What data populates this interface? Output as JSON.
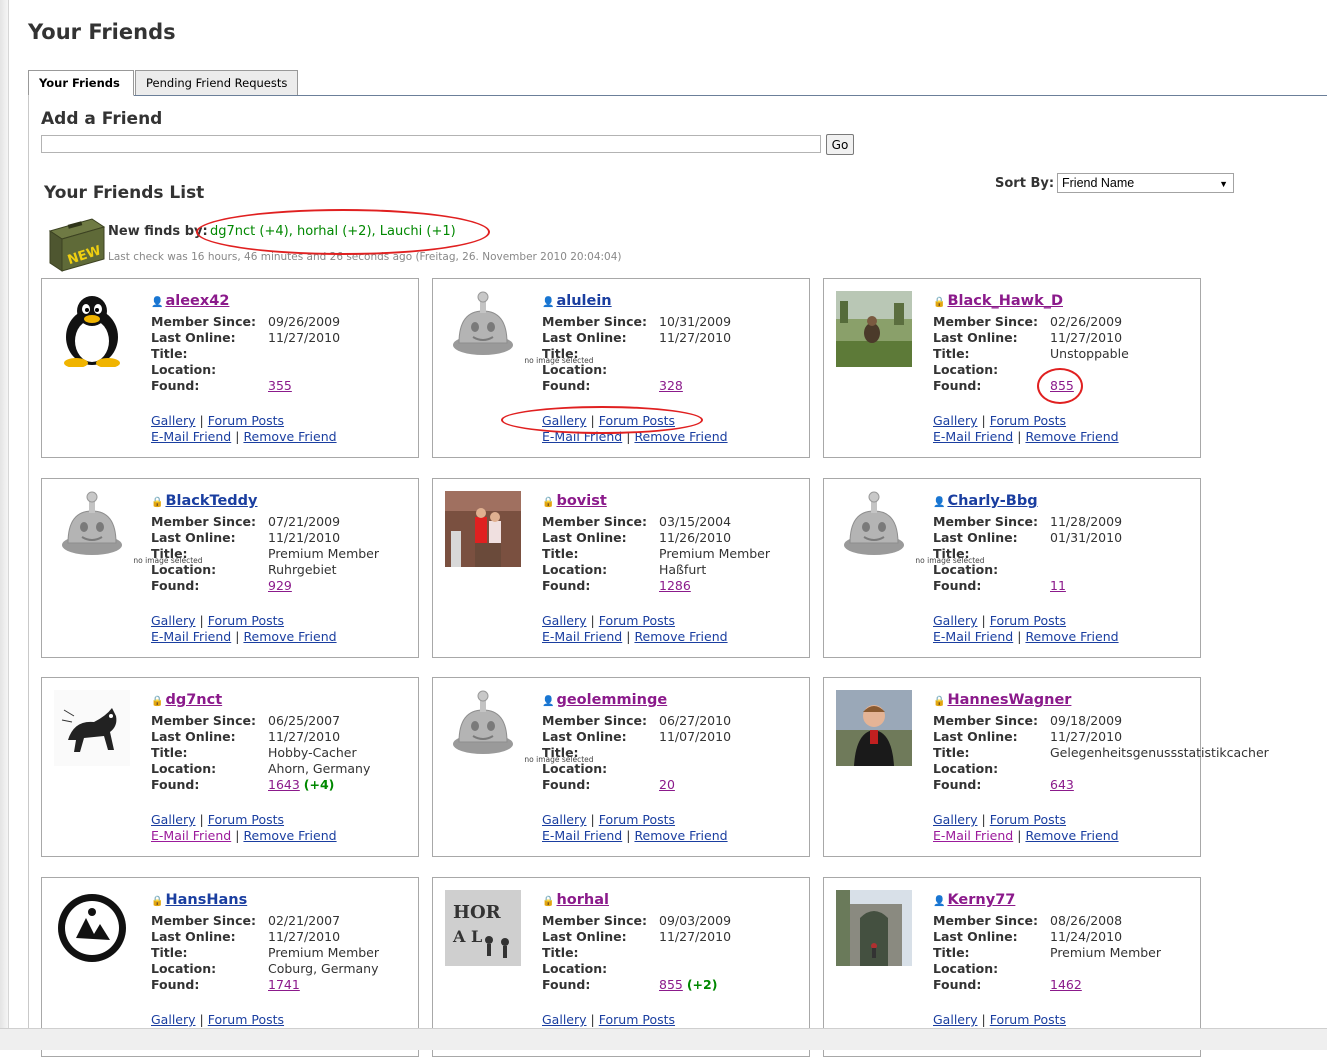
{
  "page": {
    "title": "Your Friends",
    "tabs": [
      {
        "label": "Your Friends",
        "active": true
      },
      {
        "label": "Pending Friend Requests",
        "active": false
      }
    ]
  },
  "add_friend": {
    "heading": "Add a Friend",
    "input_value": "",
    "go_label": "Go"
  },
  "friends_list": {
    "heading": "Your Friends List",
    "sort_label": "Sort By:",
    "sort_value": "Friend Name",
    "new_finds_label": "New finds by:",
    "new_finds_text": "dg7nct (+4), horhal (+2), Lauchi (+1)",
    "new_icon_text": "NEW",
    "last_check": "Last check was 16 hours, 46 minutes and 26 seconds ago (Freitag, 26. November 2010 20:04:04)"
  },
  "labels": {
    "member_since": "Member Since:",
    "last_online": "Last Online:",
    "title": "Title:",
    "location": "Location:",
    "found": "Found:",
    "gallery": "Gallery",
    "forum_posts": "Forum Posts",
    "email_friend": "E-Mail Friend",
    "remove_friend": "Remove Friend",
    "no_image": "no image selected"
  },
  "colors": {
    "link_blue": "#1a3ea0",
    "link_visited": "#8b1a8b",
    "new_finds_green": "#008800",
    "annotation_red": "#e02020"
  },
  "friends": [
    {
      "name": "aleex42",
      "member_since": "09/26/2009",
      "last_online": "11/27/2010",
      "title": "",
      "location": "",
      "found": "355",
      "found_extra": "",
      "avatar": "penguin",
      "premium": false,
      "visited": true,
      "email_visited": false
    },
    {
      "name": "alulein",
      "member_since": "10/31/2009",
      "last_online": "11/27/2010",
      "title": "",
      "location": "",
      "found": "328",
      "found_extra": "",
      "avatar": "none",
      "premium": false,
      "visited": false,
      "email_visited": false
    },
    {
      "name": "Black_Hawk_D",
      "member_since": "02/26/2009",
      "last_online": "11/27/2010",
      "title": "Unstoppable",
      "location": "",
      "found": "855",
      "found_extra": "",
      "avatar": "field-photo",
      "premium": true,
      "visited": true,
      "email_visited": false
    },
    {
      "name": "BlackTeddy",
      "member_since": "07/21/2009",
      "last_online": "11/21/2010",
      "title": "Premium Member",
      "location": "Ruhrgebiet",
      "found": "929",
      "found_extra": "",
      "avatar": "none",
      "premium": true,
      "visited": false,
      "email_visited": false
    },
    {
      "name": "bovist",
      "member_since": "03/15/2004",
      "last_online": "11/26/2010",
      "title": "Premium Member",
      "location": "Haßfurt",
      "found": "1286",
      "found_extra": "",
      "avatar": "people-photo",
      "premium": true,
      "visited": true,
      "email_visited": false
    },
    {
      "name": "Charly-Bbg",
      "member_since": "11/28/2009",
      "last_online": "01/31/2010",
      "title": "",
      "location": "",
      "found": "11",
      "found_extra": "",
      "avatar": "none",
      "premium": false,
      "visited": false,
      "email_visited": false
    },
    {
      "name": "dg7nct",
      "member_since": "06/25/2007",
      "last_online": "11/27/2010",
      "title": "Hobby-Cacher",
      "location": "Ahorn, Germany",
      "found": "1643",
      "found_extra": "(+4)",
      "avatar": "dog-drawing",
      "premium": true,
      "visited": true,
      "email_visited": true
    },
    {
      "name": "geolemminge",
      "member_since": "06/27/2010",
      "last_online": "11/07/2010",
      "title": "",
      "location": "",
      "found": "20",
      "found_extra": "",
      "avatar": "none",
      "premium": false,
      "visited": true,
      "email_visited": false
    },
    {
      "name": "HannesWagner",
      "member_since": "09/18/2009",
      "last_online": "11/27/2010",
      "title": "Gelegenheitsgenussstatistikcacher",
      "location": "",
      "found": "643",
      "found_extra": "",
      "avatar": "man-photo",
      "premium": true,
      "visited": true,
      "email_visited": true
    },
    {
      "name": "HansHans",
      "member_since": "02/21/2007",
      "last_online": "11/27/2010",
      "title": "Premium Member",
      "location": "Coburg, Germany",
      "found": "1741",
      "found_extra": "",
      "avatar": "hanshans-logo",
      "premium": true,
      "visited": false,
      "email_visited": false
    },
    {
      "name": "horhal",
      "member_since": "09/03/2009",
      "last_online": "11/27/2010",
      "title": "",
      "location": "",
      "found": "855",
      "found_extra": "(+2)",
      "avatar": "horhal-sketch",
      "premium": true,
      "visited": true,
      "email_visited": false
    },
    {
      "name": "Kerny77",
      "member_since": "08/26/2008",
      "last_online": "11/24/2010",
      "title": "Premium Member",
      "location": "",
      "found": "1462",
      "found_extra": "",
      "avatar": "gate-photo",
      "premium": false,
      "visited": true,
      "email_visited": false
    }
  ]
}
